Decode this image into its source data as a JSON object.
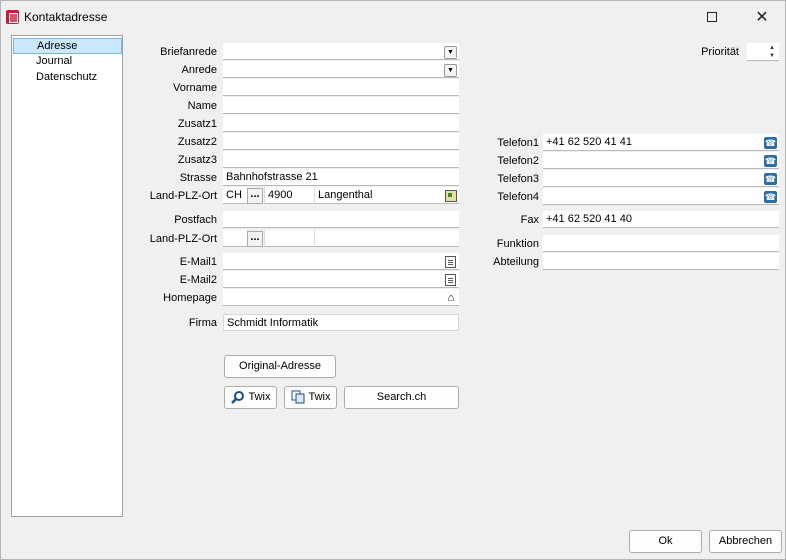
{
  "window": {
    "title": "Kontaktadresse"
  },
  "nav": {
    "items": [
      "Adresse",
      "Journal",
      "Datenschutz"
    ]
  },
  "form": {
    "briefanrede": {
      "label": "Briefanrede",
      "value": ""
    },
    "anrede": {
      "label": "Anrede",
      "value": ""
    },
    "vorname": {
      "label": "Vorname",
      "value": ""
    },
    "name": {
      "label": "Name",
      "value": ""
    },
    "zusatz1": {
      "label": "Zusatz1",
      "value": ""
    },
    "zusatz2": {
      "label": "Zusatz2",
      "value": ""
    },
    "zusatz3": {
      "label": "Zusatz3",
      "value": ""
    },
    "strasse": {
      "label": "Strasse",
      "value": "Bahnhofstrasse 21"
    },
    "land_plz_ort": {
      "label": "Land-PLZ-Ort",
      "land": "CH",
      "plz": "4900",
      "ort": "Langenthal"
    },
    "postfach": {
      "label": "Postfach",
      "value": ""
    },
    "land_plz_ort2": {
      "label": "Land-PLZ-Ort",
      "land": "",
      "plz": "",
      "ort": ""
    },
    "email1": {
      "label": "E-Mail1",
      "value": ""
    },
    "email2": {
      "label": "E-Mail2",
      "value": ""
    },
    "homepage": {
      "label": "Homepage",
      "value": ""
    },
    "firma": {
      "label": "Firma",
      "value": "Schmidt Informatik"
    },
    "dots": "...",
    "prioritaet": {
      "label": "Priorität",
      "value": ""
    },
    "telefon1": {
      "label": "Telefon1",
      "value": "+41 62 520 41 41"
    },
    "telefon2": {
      "label": "Telefon2",
      "value": ""
    },
    "telefon3": {
      "label": "Telefon3",
      "value": ""
    },
    "telefon4": {
      "label": "Telefon4",
      "value": ""
    },
    "fax": {
      "label": "Fax",
      "value": "+41 62 520 41 40"
    },
    "funktion": {
      "label": "Funktion",
      "value": ""
    },
    "abteilung": {
      "label": "Abteilung",
      "value": ""
    }
  },
  "buttons": {
    "original": "Original-Adresse",
    "twix1": "Twix",
    "twix2": "Twix",
    "search": "Search.ch",
    "ok": "Ok",
    "cancel": "Abbrechen"
  },
  "icons": {
    "app": "address-card-icon",
    "phone": "phone-icon",
    "email": "email-document-icon",
    "homepage": "home-icon",
    "map": "map-icon",
    "search": "magnifier-icon",
    "copy": "copy-icon"
  },
  "colors": {
    "selection": "#cce8ff",
    "selection_border": "#7ab7e8",
    "phone_icon": "#2c6ea8",
    "app_icon": "#b9223b"
  }
}
